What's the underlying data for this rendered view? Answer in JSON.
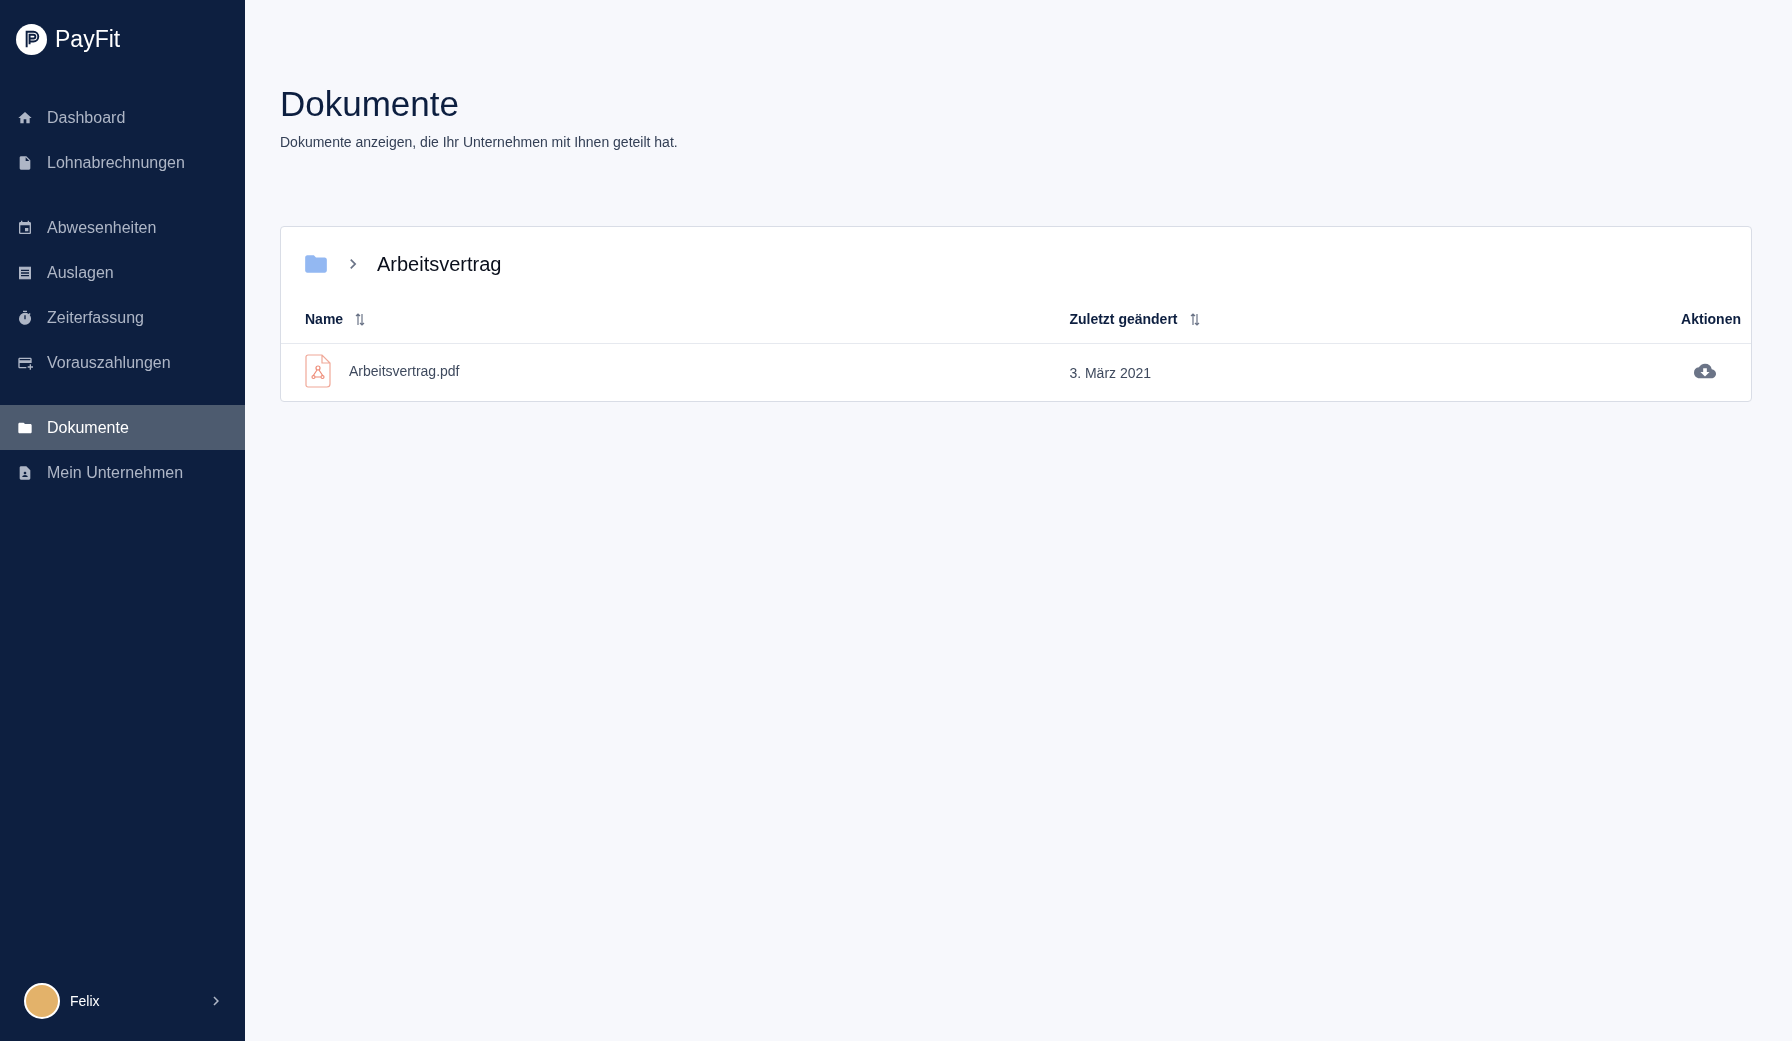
{
  "brand": {
    "name": "PayFit"
  },
  "nav_groups": [
    [
      {
        "label": "Dashboard",
        "selected": false
      },
      {
        "label": "Lohnabrechnungen",
        "selected": false
      }
    ],
    [
      {
        "label": "Abwesenheiten",
        "selected": false
      },
      {
        "label": "Auslagen",
        "selected": false
      },
      {
        "label": "Zeiterfassung",
        "selected": false
      },
      {
        "label": "Vorauszahlungen",
        "selected": false
      }
    ],
    [
      {
        "label": "Dokumente",
        "selected": true
      },
      {
        "label": "Mein Unternehmen",
        "selected": false
      }
    ]
  ],
  "user": {
    "name": "Felix"
  },
  "page": {
    "title": "Dokumente",
    "subtitle": "Dokumente anzeigen, die Ihr Unternehmen mit Ihnen geteilt hat."
  },
  "breadcrumb": {
    "folder": "Arbeitsvertrag"
  },
  "table": {
    "columns": [
      {
        "label": "Name",
        "sortable": true
      },
      {
        "label": "Zuletzt geändert",
        "sortable": true
      },
      {
        "label": "Aktionen",
        "sortable": false
      }
    ],
    "rows": [
      {
        "name": "Arbeitsvertrag.pdf",
        "modified": "3. März 2021"
      }
    ]
  }
}
